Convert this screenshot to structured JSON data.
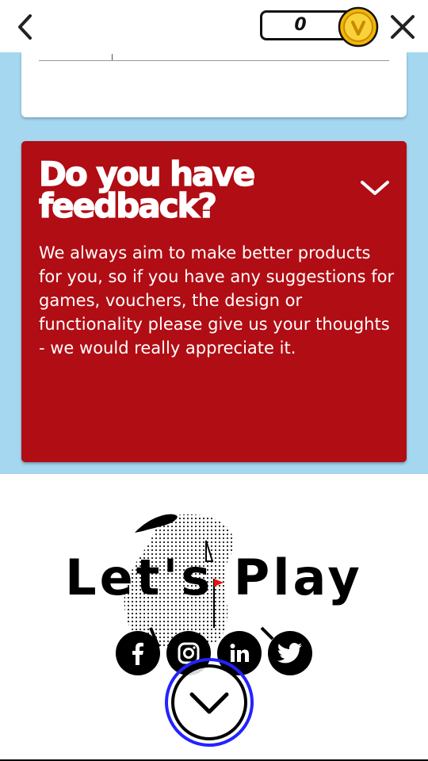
{
  "header": {
    "coin_count": "0",
    "back_icon": "chevron-left-icon",
    "close_icon": "close-icon",
    "coin_icon": "coin-icon"
  },
  "feedback": {
    "title": "Do you have feedback?",
    "body": "We always aim to make better products for you, so if you have any suggestions for games, vouchers, the design or functionality please give us your thoughts - we would really appreciate it.",
    "toggle_icon": "chevron-down-icon"
  },
  "footer": {
    "logo_text": "Let's Play",
    "social": [
      "facebook-icon",
      "instagram-icon",
      "linkedin-icon",
      "twitter-icon"
    ],
    "scroll_icon": "chevron-down-icon"
  },
  "colors": {
    "feedback_bg": "#b10d14",
    "page_bg": "#a5d7f1",
    "coin": "#f5c518",
    "focus_ring": "#2323ff"
  }
}
